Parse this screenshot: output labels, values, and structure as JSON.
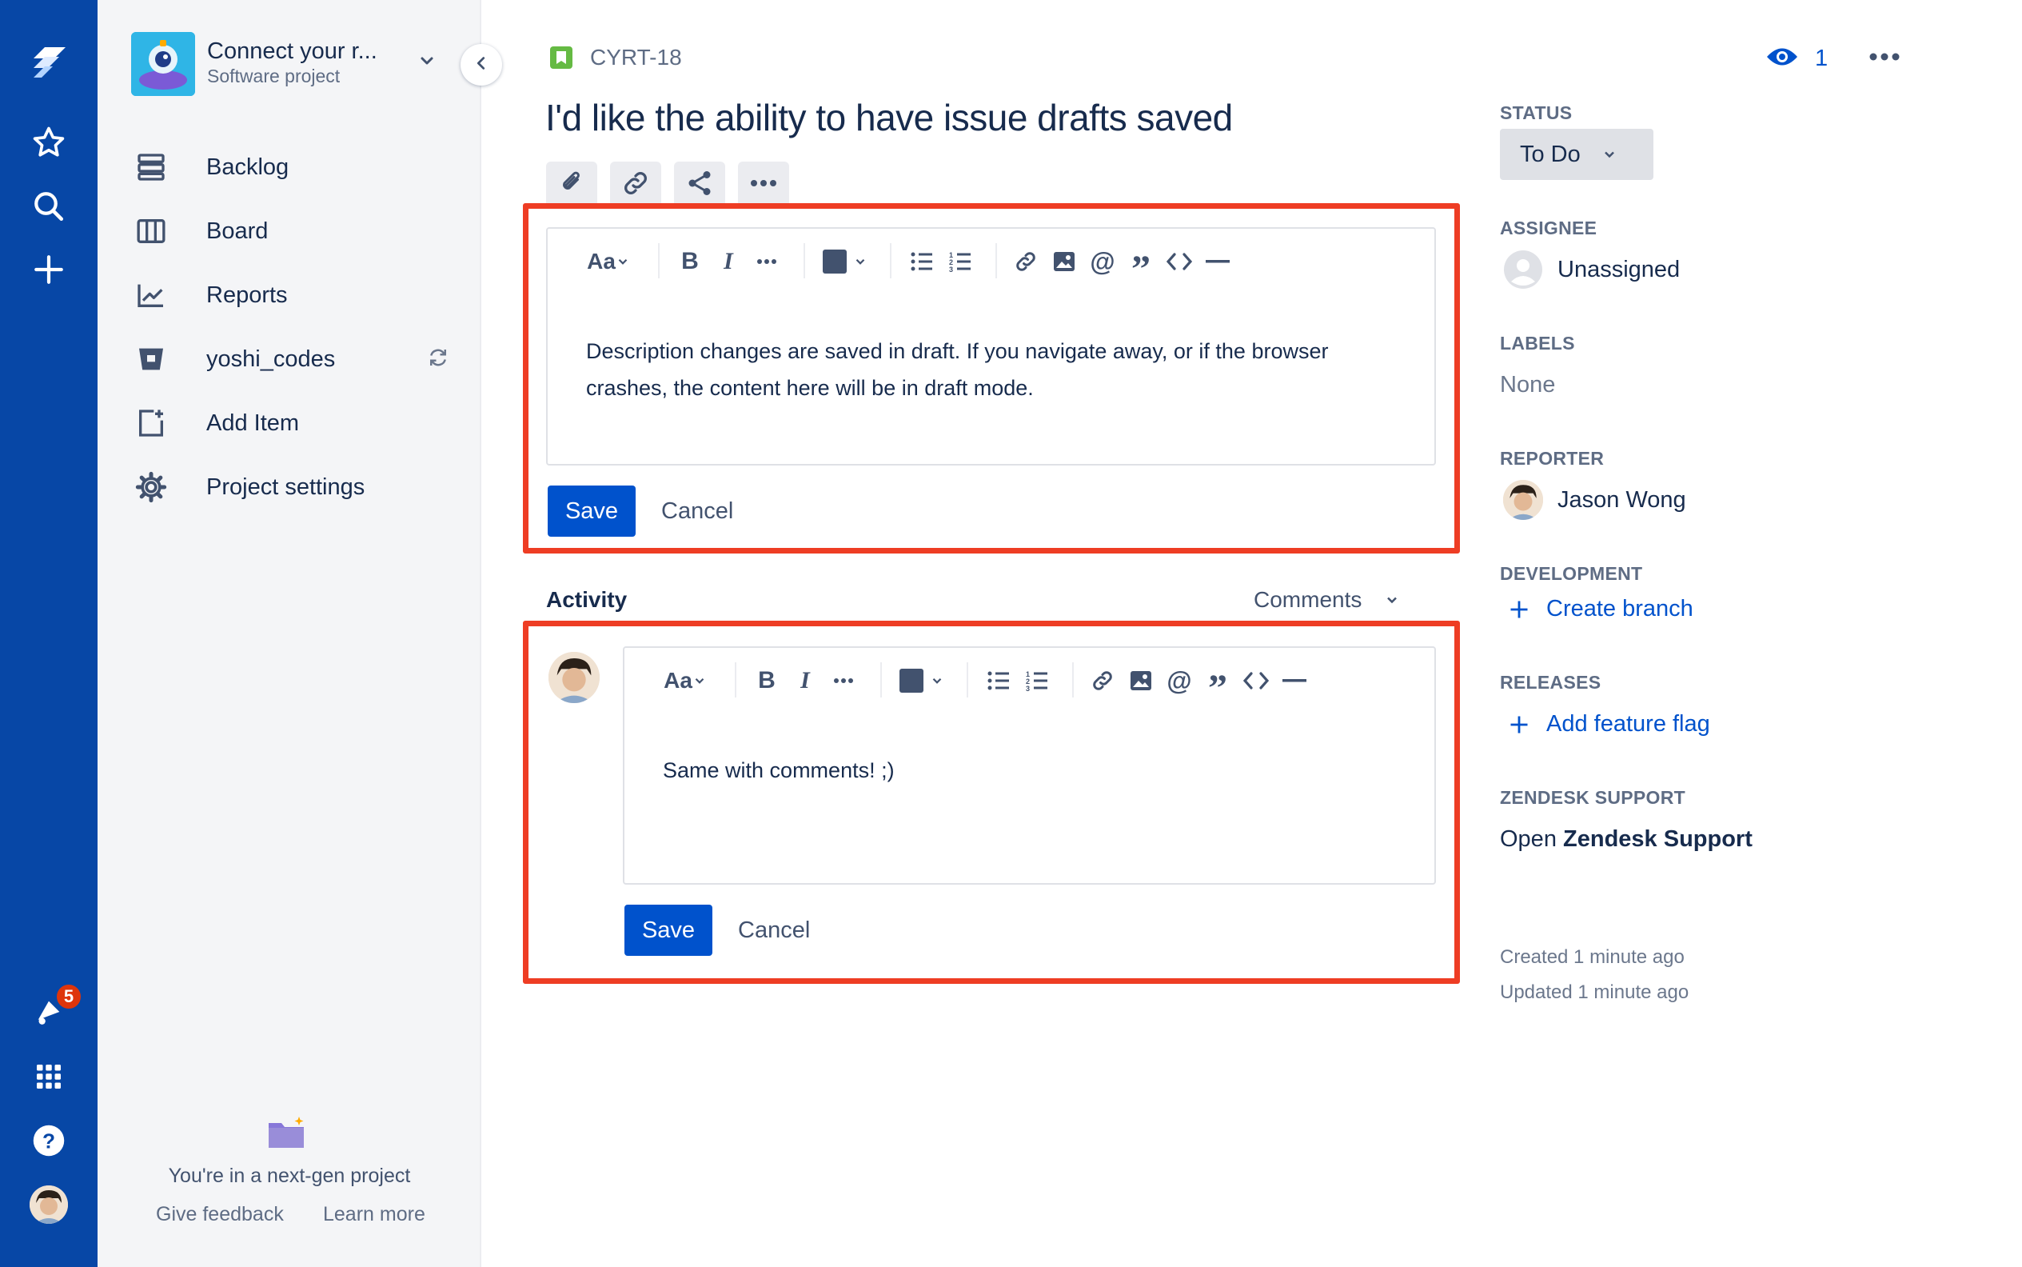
{
  "global_nav": {
    "notification_count": "5"
  },
  "sidebar": {
    "project_name": "Connect your r...",
    "project_type": "Software project",
    "items": [
      {
        "label": "Backlog"
      },
      {
        "label": "Board"
      },
      {
        "label": "Reports"
      },
      {
        "label": "yoshi_codes"
      },
      {
        "label": "Add Item"
      },
      {
        "label": "Project settings"
      }
    ],
    "footer": {
      "text": "You're in a next-gen project",
      "give_feedback": "Give feedback",
      "learn_more": "Learn more"
    }
  },
  "issue": {
    "key": "CYRT-18",
    "title": "I'd like the ability to have issue drafts saved",
    "watchers": "1",
    "description": "Description changes are saved in draft. If you navigate away, or if the browser crashes, the content here will be in draft mode.",
    "comment": "Same with comments! ;)"
  },
  "editor_toolbar": {
    "text_style": "Aa"
  },
  "actions": {
    "save": "Save",
    "cancel": "Cancel"
  },
  "activity": {
    "label": "Activity",
    "filter": "Comments"
  },
  "details": {
    "status_label": "STATUS",
    "status_value": "To Do",
    "assignee_label": "ASSIGNEE",
    "assignee_value": "Unassigned",
    "labels_label": "LABELS",
    "labels_value": "None",
    "reporter_label": "REPORTER",
    "reporter_value": "Jason Wong",
    "development_label": "DEVELOPMENT",
    "create_branch": "Create branch",
    "releases_label": "RELEASES",
    "add_feature_flag": "Add feature flag",
    "zendesk_label": "ZENDESK SUPPORT",
    "zendesk_open": "Open",
    "zendesk_name": "Zendesk Support",
    "created": "Created 1 minute ago",
    "updated": "Updated 1 minute ago"
  },
  "colors": {
    "nav_bg": "#0747a6",
    "primary": "#0052cc",
    "highlight": "#ee3d24",
    "story": "#65ba43"
  }
}
